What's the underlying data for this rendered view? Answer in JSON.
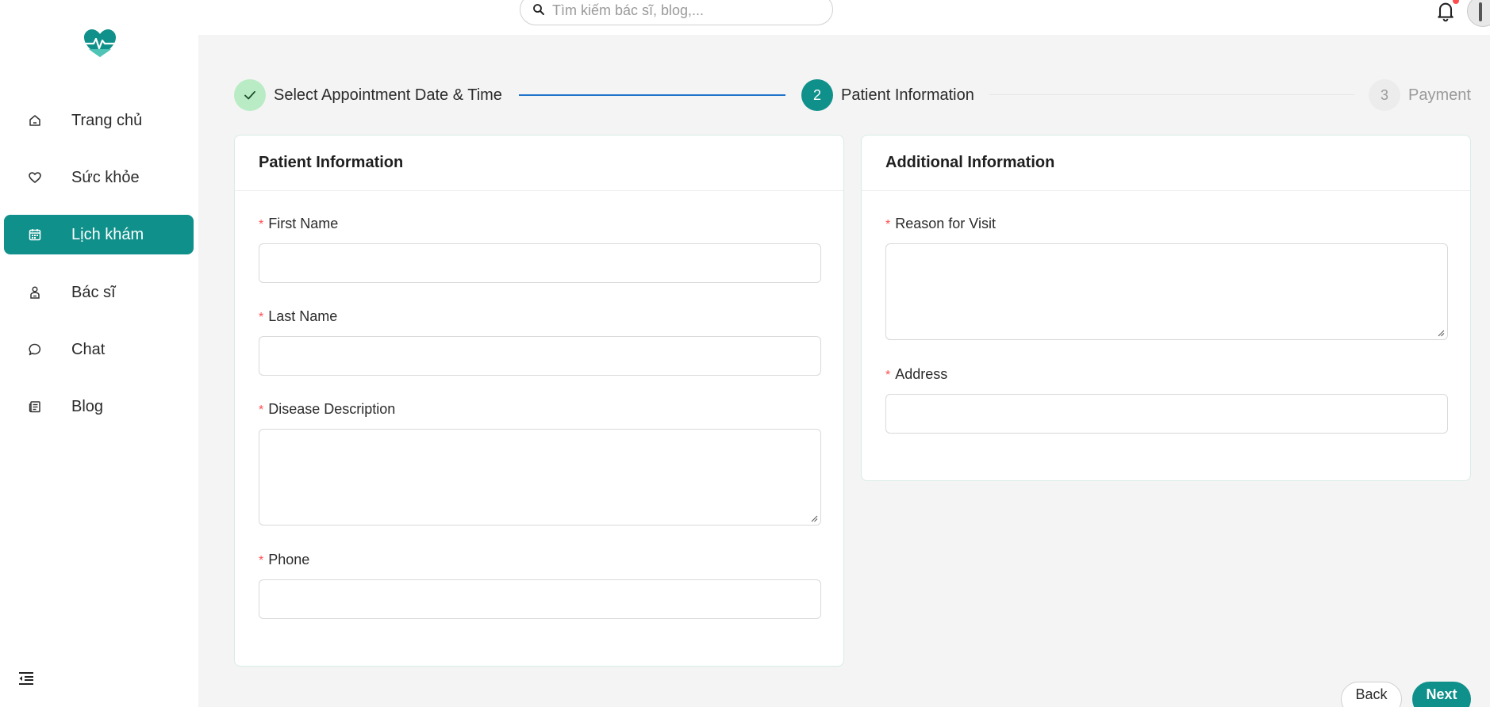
{
  "header": {
    "search_placeholder": "Tìm kiếm bác sĩ, blog,..."
  },
  "sidebar": {
    "items": [
      {
        "label": "Trang chủ",
        "icon": "home-icon"
      },
      {
        "label": "Sức khỏe",
        "icon": "heart-icon"
      },
      {
        "label": "Lịch khám",
        "icon": "calendar-icon",
        "active": true
      },
      {
        "label": "Bác sĩ",
        "icon": "doctor-icon"
      },
      {
        "label": "Chat",
        "icon": "chat-icon"
      },
      {
        "label": "Blog",
        "icon": "blog-icon"
      }
    ]
  },
  "steps": [
    {
      "label": "Select Appointment Date & Time",
      "status": "done"
    },
    {
      "number": "2",
      "label": "Patient Information",
      "status": "active"
    },
    {
      "number": "3",
      "label": "Payment",
      "status": "pending"
    }
  ],
  "patient_card": {
    "title": "Patient Information",
    "fields": {
      "first_name": "First Name",
      "last_name": "Last Name",
      "disease": "Disease Description",
      "phone": "Phone"
    },
    "required_mark": "*"
  },
  "additional_card": {
    "title": "Additional Information",
    "fields": {
      "reason": "Reason for Visit",
      "address": "Address"
    },
    "required_mark": "*"
  },
  "buttons": {
    "back": "Back",
    "next": "Next"
  },
  "colors": {
    "primary": "#10908a",
    "done_step": "#b9ecc5",
    "progress_line": "#1f73c9",
    "required": "#ff4d4f"
  }
}
